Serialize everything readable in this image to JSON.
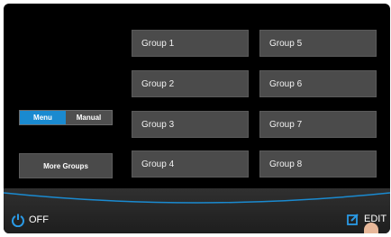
{
  "mode_toggle": {
    "options": [
      "Menu",
      "Manual"
    ],
    "selected": "Menu"
  },
  "more_groups_label": "More Groups",
  "groups": [
    "Group 1",
    "Group 2",
    "Group 3",
    "Group 4",
    "Group 5",
    "Group 6",
    "Group 7",
    "Group 8"
  ],
  "footer": {
    "off_label": "OFF",
    "edit_label": "EDIT",
    "off_icon": "power-icon",
    "edit_icon": "edit-icon"
  },
  "colors": {
    "accent": "#1a8ad0",
    "button_bg": "#4b4b4b",
    "screen_bg": "#000000"
  }
}
